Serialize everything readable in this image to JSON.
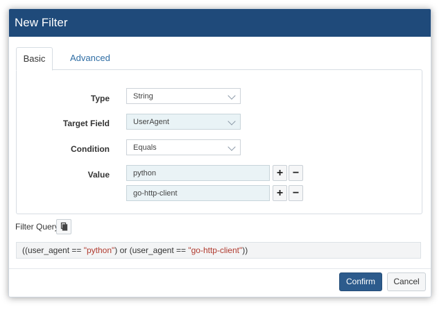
{
  "dialog": {
    "title": "New Filter"
  },
  "tabs": [
    {
      "label": "Basic",
      "active": true
    },
    {
      "label": "Advanced",
      "active": false
    }
  ],
  "form": {
    "type": {
      "label": "Type",
      "value": "String"
    },
    "target_field": {
      "label": "Target Field",
      "value": "UserAgent"
    },
    "condition": {
      "label": "Condition",
      "value": "Equals"
    },
    "value": {
      "label": "Value",
      "items": [
        "python",
        "go-http-client"
      ]
    }
  },
  "icons": {
    "add": "+",
    "remove": "−",
    "copy": "copy-icon"
  },
  "filter_query": {
    "label": "Filter Query",
    "parts": [
      "((user_agent == ",
      "\"python\"",
      ") or (user_agent == ",
      "\"go-http-client\"",
      "))"
    ]
  },
  "buttons": {
    "confirm": "Confirm",
    "cancel": "Cancel"
  },
  "colors": {
    "header": "#1f4a7a",
    "primary_button": "#2d5b8c",
    "query_string": "#b03a2e"
  }
}
